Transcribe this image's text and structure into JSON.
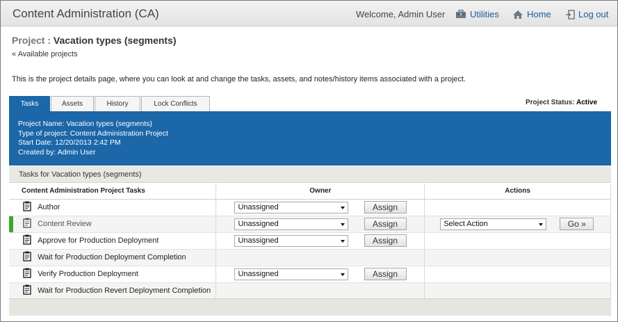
{
  "header": {
    "app_title": "Content Administration (CA)",
    "welcome": "Welcome, Admin User",
    "utilities": "Utilities",
    "home": "Home",
    "logout": "Log out"
  },
  "project": {
    "label": "Project :",
    "name": "Vacation types (segments)",
    "back_link": "« Available projects",
    "intro": "This is the project details page, where you can look at and change the tasks, assets, and notes/history items associated with a project."
  },
  "tabs": [
    "Tasks",
    "Assets",
    "History",
    "Lock Conflicts"
  ],
  "status": {
    "label": "Project Status:",
    "value": "Active"
  },
  "info": {
    "name": "Project Name: Vacation types (segments)",
    "type": "Type of project: Content Administration Project",
    "start": "Start Date: 12/20/2013 2:42 PM",
    "created": "Created by: Admin  User"
  },
  "tasks_heading": "Tasks for Vacation types (segments)",
  "table": {
    "headers": [
      "Content Administration Project Tasks",
      "Owner",
      "Actions"
    ],
    "rows": [
      {
        "task": "Author",
        "owner": "Unassigned",
        "assign": "Assign"
      },
      {
        "task": "Content Review",
        "owner": "Unassigned",
        "assign": "Assign",
        "action": "Select Action",
        "go": "Go »"
      },
      {
        "task": "Approve for Production Deployment",
        "owner": "Unassigned",
        "assign": "Assign"
      },
      {
        "task": "Wait for Production Deployment Completion"
      },
      {
        "task": "Verify Production Deployment",
        "owner": "Unassigned",
        "assign": "Assign"
      },
      {
        "task": "Wait for Production Revert Deployment Completion"
      }
    ]
  },
  "colors": {
    "accent": "#1c67a8",
    "highlight": "#3ea630",
    "link": "#1f5a99"
  },
  "icons": [
    "toolbox-icon",
    "home-icon",
    "logout-icon",
    "clipboard-icon"
  ]
}
